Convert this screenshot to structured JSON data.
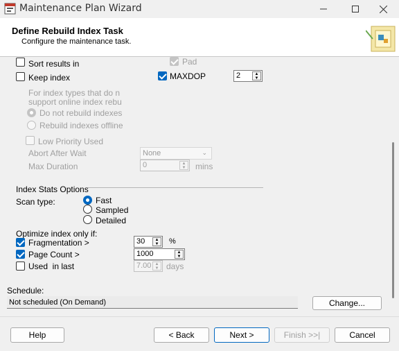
{
  "window": {
    "title": "Maintenance Plan Wizard"
  },
  "header": {
    "title": "Define Rebuild Index Task",
    "subtitle": "Configure the maintenance task."
  },
  "options": {
    "sort_results": {
      "label": "Sort results in",
      "checked": false
    },
    "pad": {
      "label": "Pad",
      "checked": true,
      "enabled": false
    },
    "keep_index": {
      "label": "Keep index",
      "checked": false
    },
    "maxdop": {
      "label": "MAXDOP",
      "checked": true,
      "value": "2"
    },
    "online_note_line1": "For index types that do n",
    "online_note_line2": "support online index rebu",
    "do_not_rebuild": {
      "label": "Do not rebuild indexes",
      "selected": true
    },
    "rebuild_offline": {
      "label": "Rebuild indexes offline",
      "selected": false
    },
    "low_priority": {
      "label": "Low Priority Used",
      "checked": false
    },
    "abort_after_wait": {
      "label": "Abort After Wait",
      "value": "None"
    },
    "max_duration": {
      "label": "Max Duration",
      "value": "0",
      "unit": "mins"
    }
  },
  "index_stats": {
    "group_label": "Index Stats Options",
    "scan_type_label": "Scan type:",
    "scan_options": [
      {
        "label": "Fast",
        "selected": true
      },
      {
        "label": "Sampled",
        "selected": false
      },
      {
        "label": "Detailed",
        "selected": false
      }
    ]
  },
  "optimize": {
    "label": "Optimize index only if:",
    "fragmentation": {
      "label": "Fragmentation >",
      "checked": true,
      "value": "30",
      "unit": "%"
    },
    "page_count": {
      "label": "Page Count >",
      "checked": true,
      "value": "1000"
    },
    "used_in_last": {
      "label": "Used  in last",
      "checked": false,
      "value": "7.00",
      "unit": "days"
    }
  },
  "schedule": {
    "label": "Schedule:",
    "value": "Not scheduled (On Demand)",
    "change_label": "Change..."
  },
  "footer": {
    "help": "Help",
    "back": "< Back",
    "next": "Next >",
    "finish": "Finish >>|",
    "cancel": "Cancel"
  },
  "colors": {
    "accent": "#0067c0",
    "disabled_text": "#a0a0a0"
  }
}
